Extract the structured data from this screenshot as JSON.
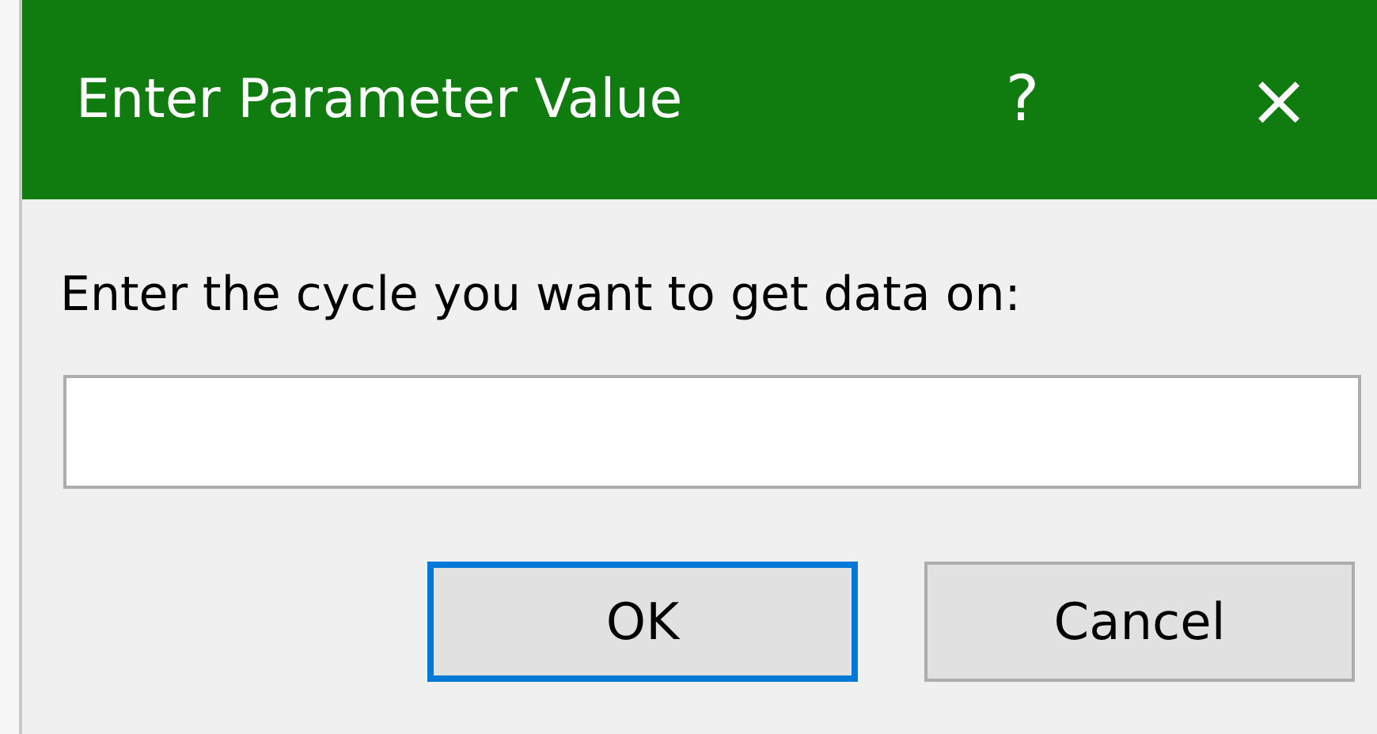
{
  "window": {
    "title": "Enter Parameter Value",
    "help": "?",
    "close": "×"
  },
  "prompt": "Enter the cycle you want to get data on:",
  "buttons": [
    {
      "label": "OK",
      "focused": true
    },
    {
      "label": "Cancel",
      "focused": false
    }
  ]
}
